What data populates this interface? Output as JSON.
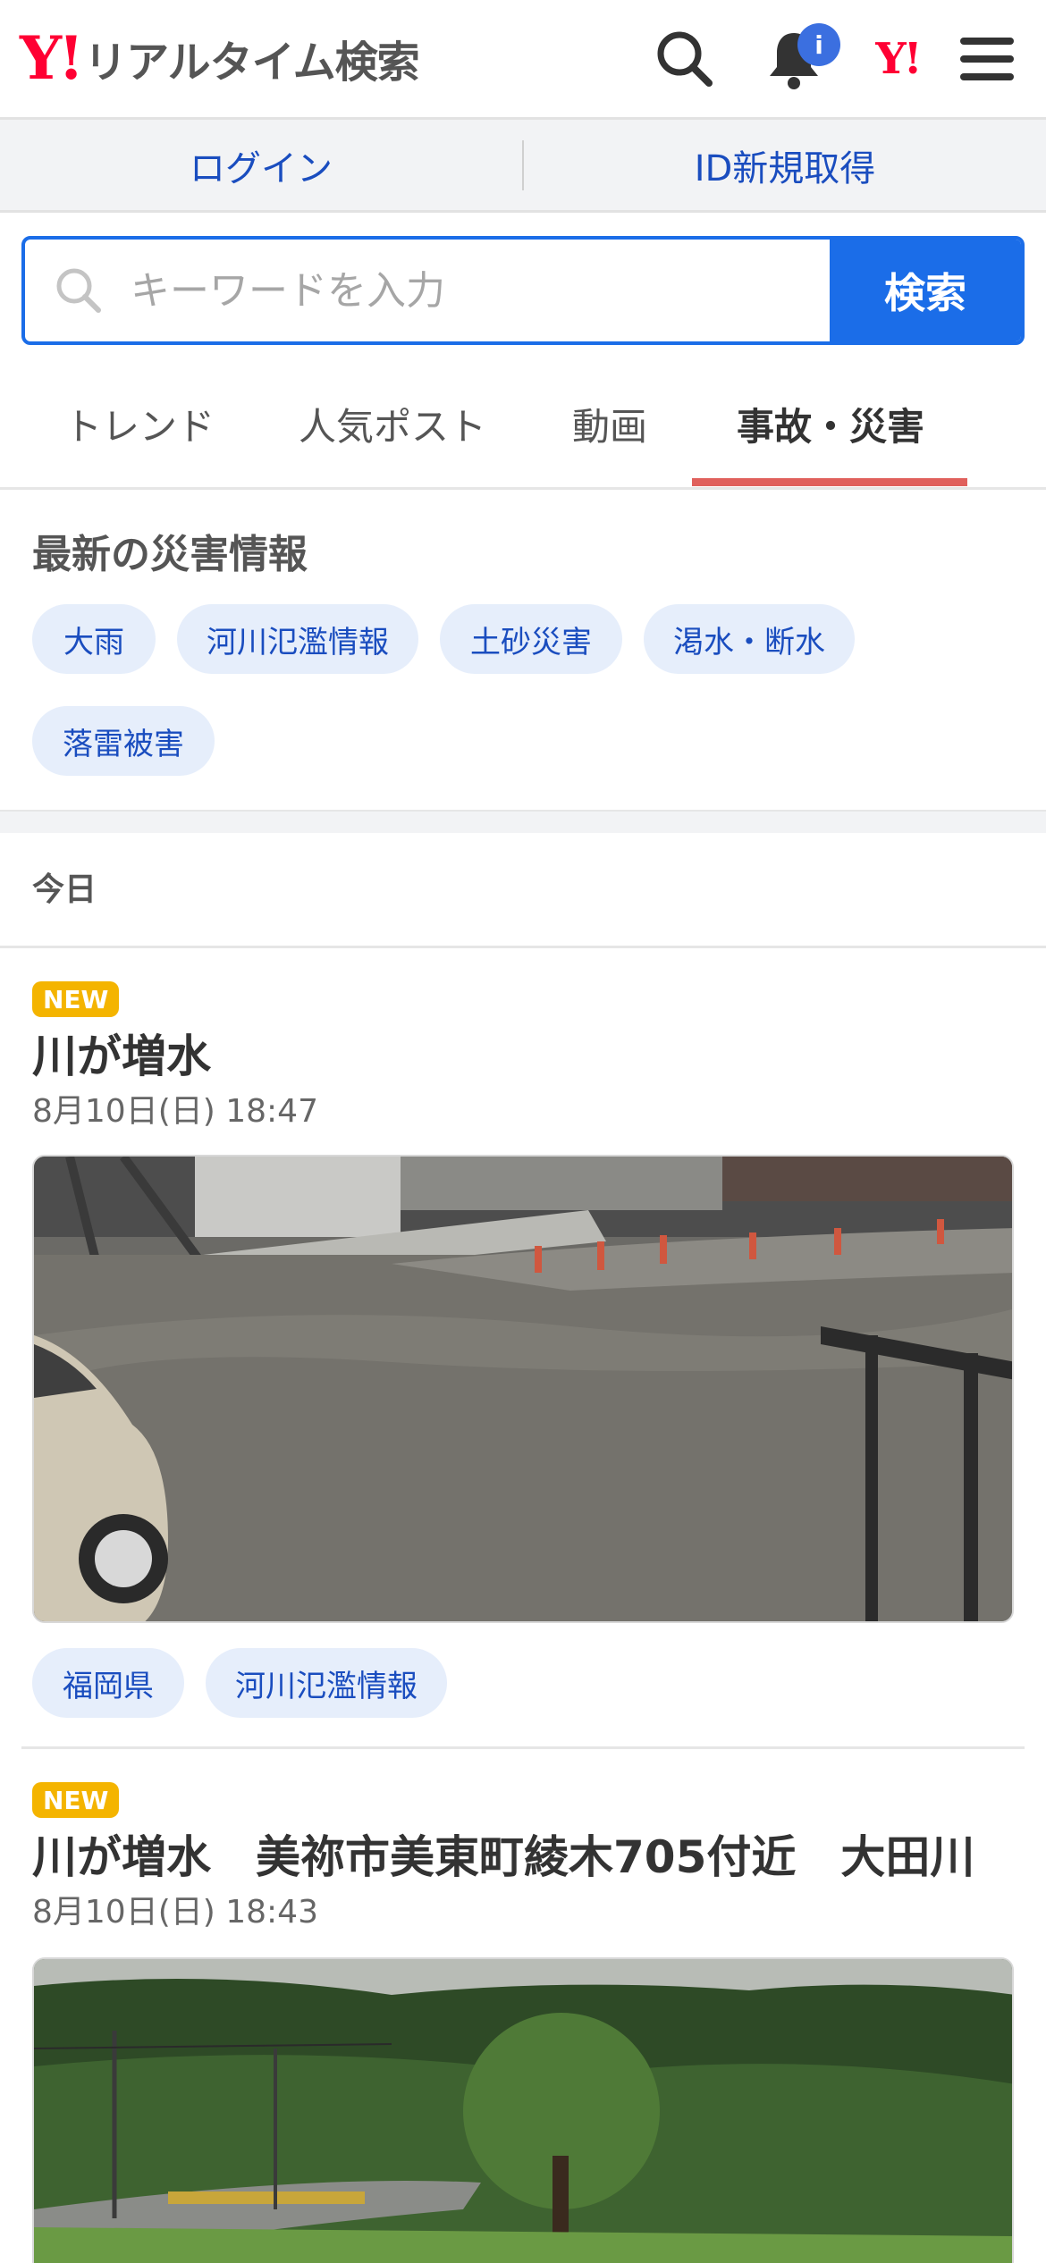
{
  "header": {
    "logo_mark": "Y!",
    "logo_text": "リアルタイム検索",
    "notification_badge": "i",
    "yahoo_mark": "Y!"
  },
  "account": {
    "login": "ログイン",
    "register": "ID新規取得"
  },
  "search": {
    "placeholder": "キーワードを入力",
    "button": "検索"
  },
  "tabs": [
    "トレンド",
    "人気ポスト",
    "動画",
    "事故・災害"
  ],
  "disaster": {
    "title": "最新の災害情報",
    "chips": [
      "大雨",
      "河川氾濫情報",
      "土砂災害",
      "渇水・断水",
      "落雷被害"
    ]
  },
  "day_label": "今日",
  "posts": [
    {
      "badge": "NEW",
      "title": "川が増水",
      "date": "8月10日(日) 18:47",
      "tags": [
        "福岡県",
        "河川氾濫情報"
      ]
    },
    {
      "badge": "NEW",
      "title": "川が増水　美祢市美東町綾木705付近　大田川",
      "date": "8月10日(日) 18:43"
    }
  ],
  "colors": {
    "brand_red": "#ff0033",
    "accent_blue": "#1b6de8",
    "link_blue": "#1a4dbf",
    "chip_bg": "#e6eefb",
    "active_tab_underline": "#e0605c",
    "new_badge": "#f4b400"
  }
}
